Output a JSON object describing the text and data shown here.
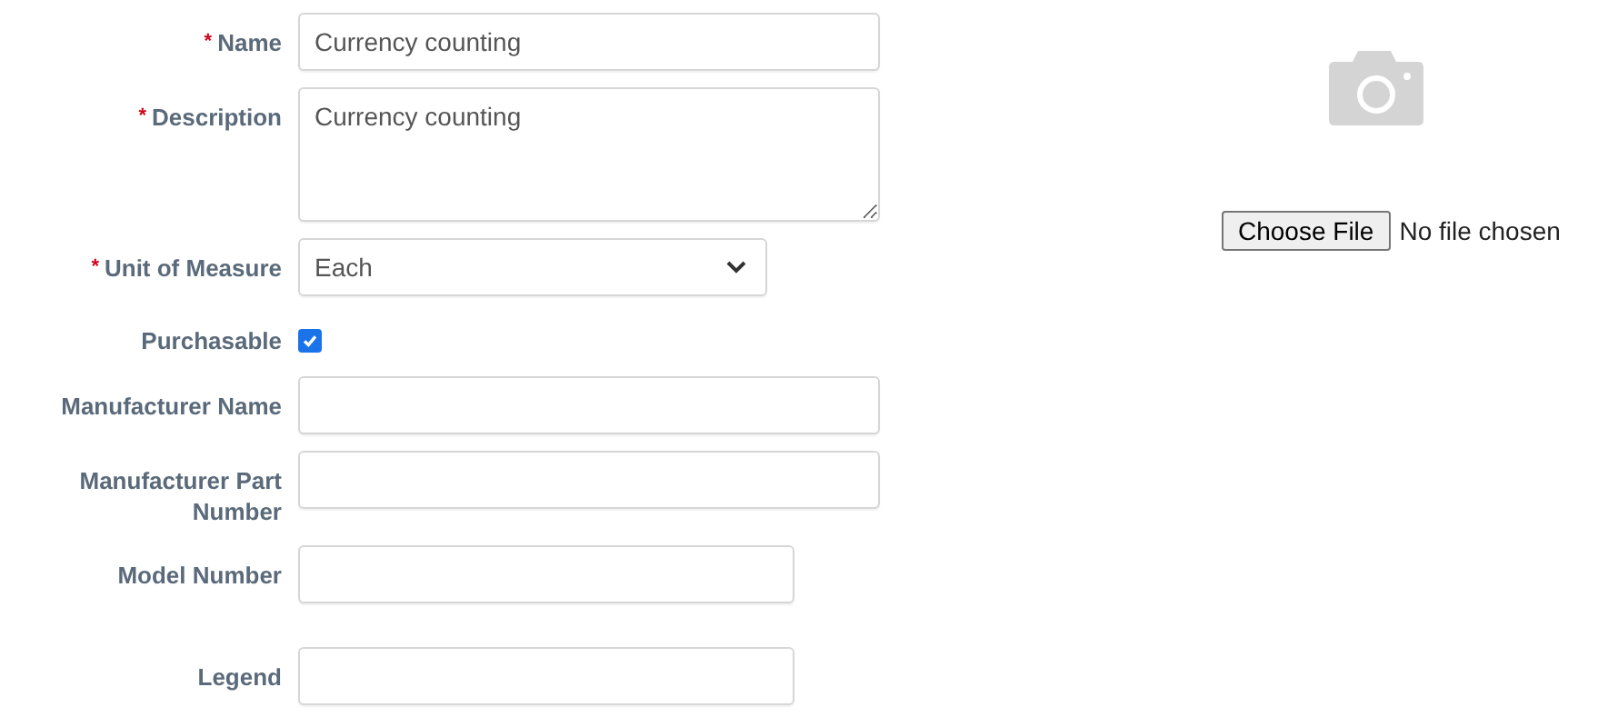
{
  "fields": [
    {
      "label": "Name",
      "required": true,
      "kind": "text",
      "value": "Currency counting"
    },
    {
      "label": "Description",
      "required": true,
      "kind": "textarea",
      "value": "Currency counting"
    },
    {
      "label": "Unit of Measure",
      "required": true,
      "kind": "select",
      "value": "Each"
    },
    {
      "label": "Purchasable",
      "required": false,
      "kind": "checkbox",
      "checked": true
    },
    {
      "label": "Manufacturer Name",
      "required": false,
      "kind": "text"
    },
    {
      "label": "Manufacturer Part Number",
      "required": false,
      "kind": "text"
    },
    {
      "label": "Model Number",
      "required": false,
      "kind": "short-text"
    },
    {
      "label": "Legend",
      "required": false,
      "kind": "short-text"
    }
  ],
  "required_mark": "*",
  "image_upload": {
    "button": "Choose File",
    "status": "No file chosen"
  }
}
